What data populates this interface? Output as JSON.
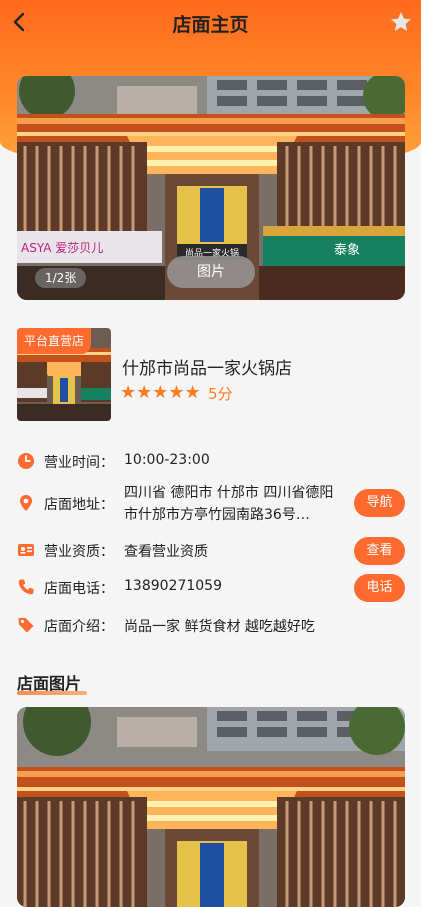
{
  "header": {
    "title": "店面主页",
    "back_icon": "chevron-left-icon",
    "favorite_icon": "star-icon"
  },
  "hero": {
    "counter": "1/2张",
    "image_button": "图片",
    "sign_center": "尚品一家火锅",
    "sign_left": "ASYA 爱莎贝儿",
    "sign_right": "泰象"
  },
  "store": {
    "badge": "平台直营店",
    "name": "什邡市尚品一家火锅店",
    "stars": "★★★★★",
    "score": "5分"
  },
  "info": {
    "hours_label": "营业时间：",
    "hours_value": "10:00-23:00",
    "address_label": "店面地址：",
    "address_value": "四川省 德阳市 什邡市 四川省德阳市什邡市方亭竹园南路36号…",
    "nav_button": "导航",
    "license_label": "营业资质：",
    "license_value": "查看营业资质",
    "view_button": "查看",
    "phone_label": "店面电话：",
    "phone_value": "13890271059",
    "call_button": "电话",
    "intro_label": "店面介绍：",
    "intro_value": "尚品一家  鲜货食材  越吃越好吃"
  },
  "gallery": {
    "title": "店面图片"
  },
  "colors": {
    "accent": "#ff6a2e",
    "header_gradient_top": "#ff6a1e",
    "star": "#ff7a22"
  }
}
